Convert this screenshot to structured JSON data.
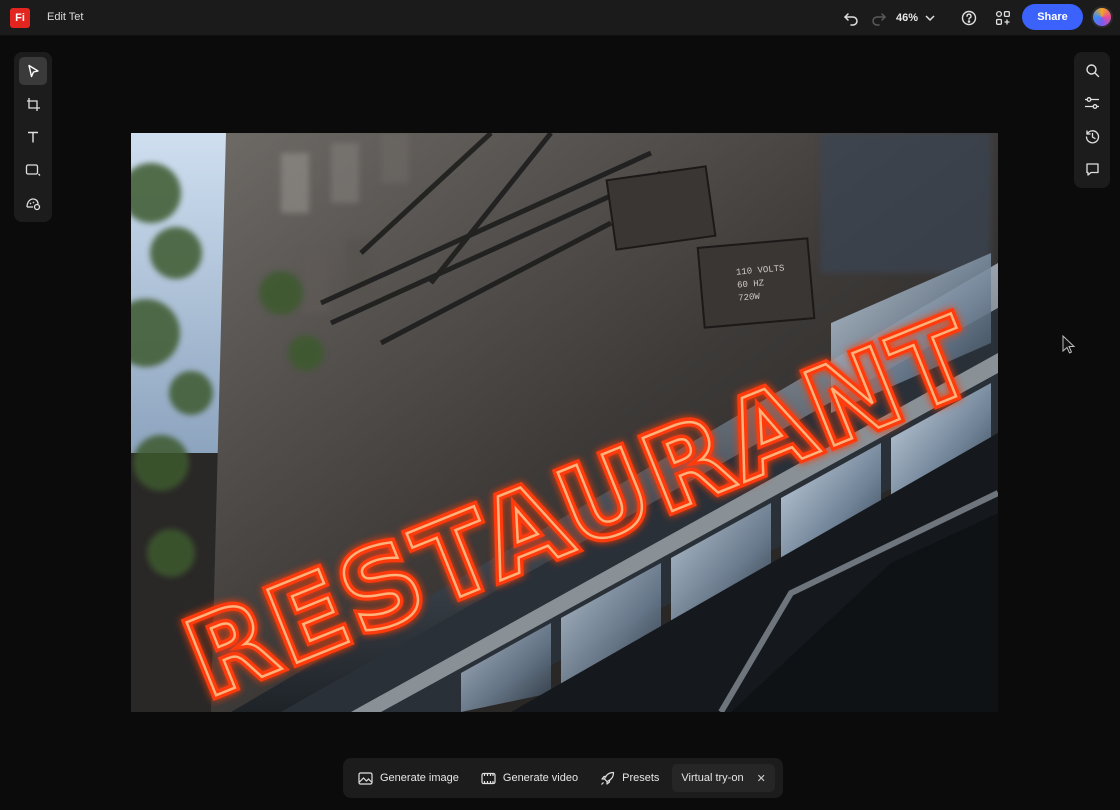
{
  "app": {
    "logo_text": "Fi",
    "brand_color": "#e3251f"
  },
  "header": {
    "doc_title": "Edit Tet",
    "zoom": "46%",
    "share_label": "Share",
    "accent": "#3b63fb"
  },
  "left_tools": [
    "select-icon",
    "crop-icon",
    "text-icon",
    "shape-icon",
    "generative-fill-icon"
  ],
  "right_tools": [
    "search-icon",
    "adjustments-icon",
    "history-icon",
    "comment-icon"
  ],
  "canvas": {
    "sign_text": "RESTAURANT",
    "sign_sub": [
      "110 VOLTS",
      "60 HZ",
      "720W"
    ]
  },
  "bottom_bar": {
    "generate_image": "Generate image",
    "generate_video": "Generate video",
    "presets": "Presets",
    "virtual_tryon": "Virtual try-on",
    "close": "✕"
  }
}
